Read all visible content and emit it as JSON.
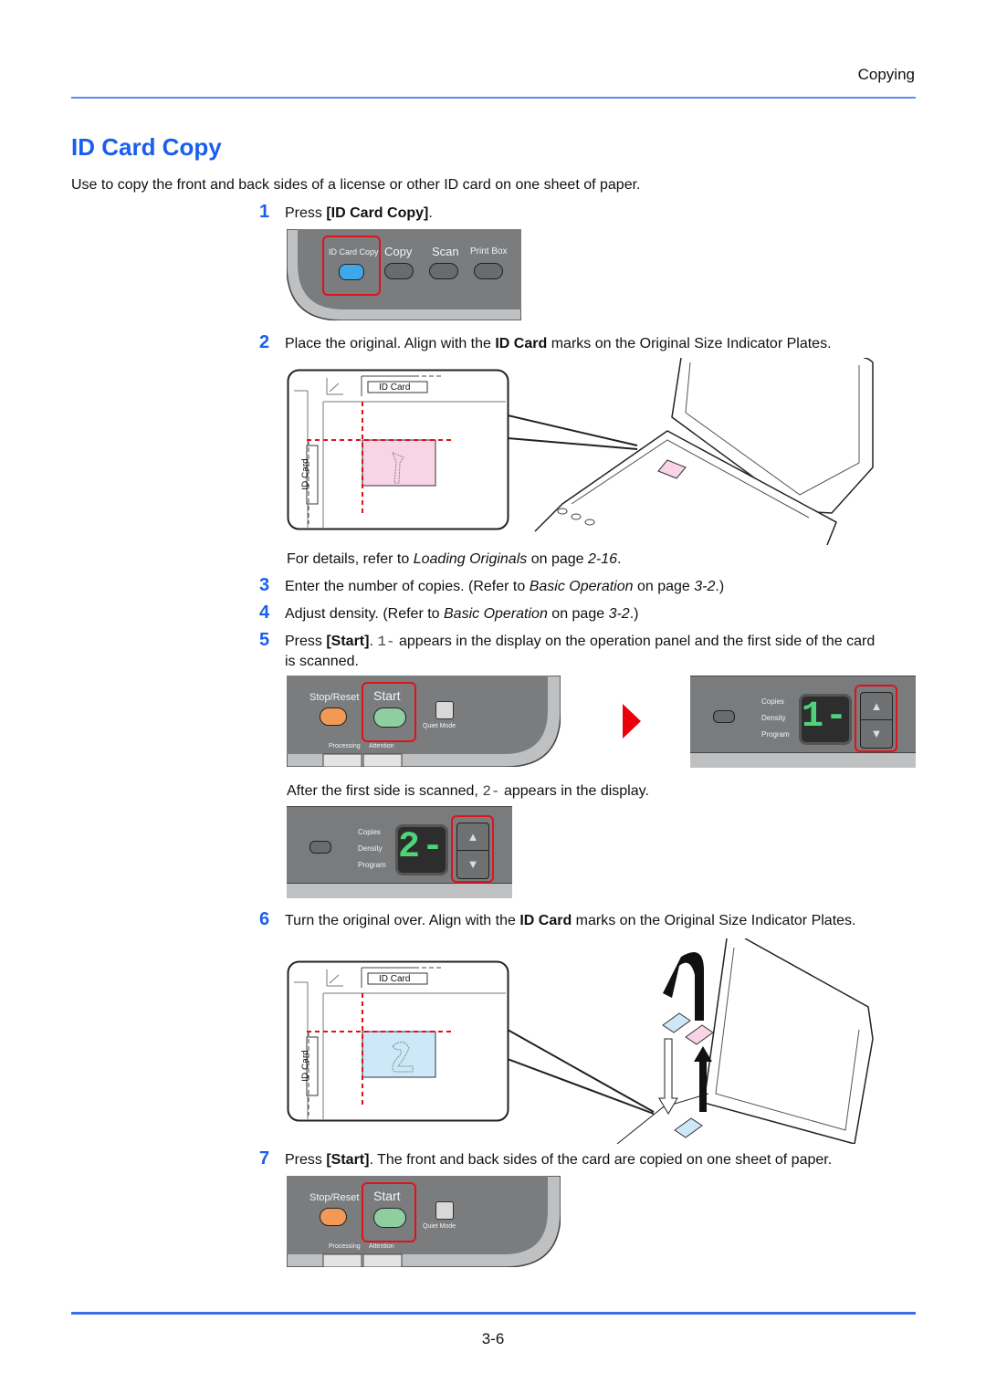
{
  "header": {
    "section": "Copying"
  },
  "title": "ID Card Copy",
  "intro": "Use to copy the front and back sides of a license or other ID card on one sheet of paper.",
  "steps": [
    {
      "num": "1",
      "parts": {
        "a": "Press ",
        "b": "[ID Card Copy]",
        "c": "."
      }
    },
    {
      "num": "2",
      "parts": {
        "a": "Place the original. Align with the ",
        "b": "ID Card",
        "c": " marks on the Original Size Indicator Plates."
      },
      "details": {
        "a": "For details, refer to ",
        "i": "Loading Originals",
        "c": " on page ",
        "p": "2-16",
        "d": "."
      }
    },
    {
      "num": "3",
      "parts": {
        "a": "Enter the number of copies. (Refer to ",
        "i": "Basic Operation",
        "c": " on page ",
        "p": "3-2",
        "d": ".)"
      }
    },
    {
      "num": "4",
      "parts": {
        "a": "Adjust density. (Refer to ",
        "i": "Basic Operation",
        "c": " on page ",
        "p": "3-2",
        "d": ".)"
      }
    },
    {
      "num": "5",
      "parts": {
        "a": "Press ",
        "b": "[Start]",
        "c": ". ",
        "m": "1-",
        "d": " appears in the display on the operation panel and the first side of the card",
        "e": "is scanned."
      },
      "after": {
        "a": "After the first side is scanned, ",
        "m": "2-",
        "c": " appears in the display."
      }
    },
    {
      "num": "6",
      "parts": {
        "a": "Turn the original over. Align with the ",
        "b": "ID Card",
        "c": " marks on the Original Size Indicator Plates."
      }
    },
    {
      "num": "7",
      "parts": {
        "a": "Press ",
        "b": "[Start]",
        "c": ". The front and back sides of the card are copied on one sheet of paper."
      }
    }
  ],
  "panel_mode": {
    "buttons": [
      "ID Card Copy",
      "Copy",
      "Scan",
      "Print Box"
    ]
  },
  "panel_start": {
    "stop": "Stop/Reset",
    "start": "Start",
    "quiet": "Quiet Mode",
    "processing": "Processing",
    "attention": "Attention"
  },
  "panel_display": {
    "labels": [
      "Copies",
      "Density",
      "Program"
    ],
    "display_1": "1-",
    "display_2": "2-",
    "up": "▲",
    "down": "▼"
  },
  "plate": {
    "label": "ID Card",
    "front_mark": "1",
    "back_mark": "2"
  },
  "colors": {
    "accent": "#1a5ef0",
    "highlight": "#e0121c",
    "card_front": "#f8d4e6",
    "card_back": "#cde8f8",
    "segment": "#4ed27a"
  },
  "footer": {
    "page": "3-6"
  }
}
